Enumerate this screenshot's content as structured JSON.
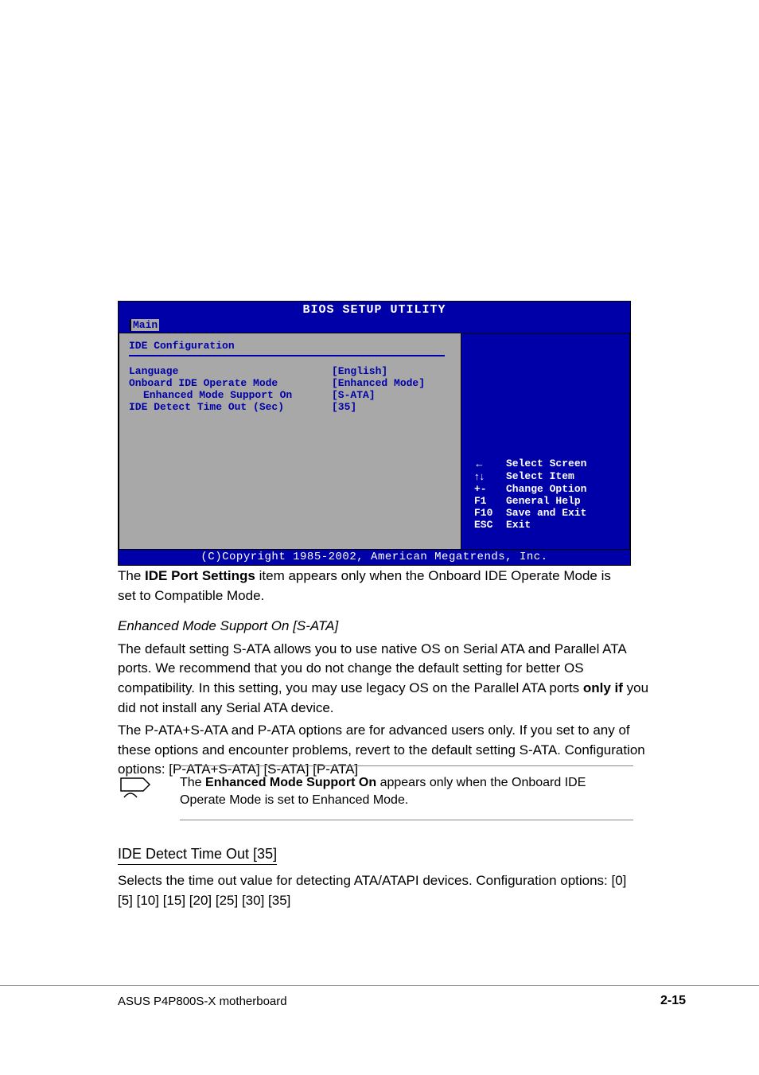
{
  "bios": {
    "title": "BIOS SETUP UTILITY",
    "active_tab": "Main",
    "section_heading": "IDE Configuration",
    "settings": [
      {
        "label": "Language",
        "value": "[English]",
        "indent": false
      },
      {
        "label": "Onboard IDE Operate Mode",
        "value": "[Enhanced Mode]",
        "indent": false
      },
      {
        "label": "Enhanced Mode Support On",
        "value": "[S-ATA]",
        "indent": true
      },
      {
        "label": "IDE Detect Time Out (Sec)",
        "value": "[35]",
        "indent": false
      }
    ],
    "help_keys": [
      {
        "key_glyph": "←",
        "key_text": "",
        "desc": "Select Screen"
      },
      {
        "key_glyph": "↑↓",
        "key_text": "",
        "desc": "Select Item"
      },
      {
        "key_glyph": "",
        "key_text": "+-",
        "desc": "Change Option"
      },
      {
        "key_glyph": "",
        "key_text": "F1",
        "desc": "General Help"
      },
      {
        "key_glyph": "",
        "key_text": "F10",
        "desc": "Save and Exit"
      },
      {
        "key_glyph": "",
        "key_text": "ESC",
        "desc": "Exit"
      }
    ],
    "copyright": "(C)Copyright 1985-2002, American Megatrends, Inc."
  },
  "text": {
    "para1_prefix": "The ",
    "para1_bold": "IDE Port Settings",
    "para1_suffix": " item appears only when the Onboard IDE Operate Mode is set to Compatible Mode.",
    "enhanced_italic": "Enhanced Mode Support On [S-ATA]",
    "enhanced_desc": "The default setting S-ATA allows you to use native OS on Serial ATA and Parallel ATA ports. We recommend that you do not change the default setting for better OS compatibility. In this setting, you may use legacy OS on the Parallel ATA ports ",
    "enhanced_bold_tail": "only if",
    "enhanced_tail2": " you did not install any Serial ATA device.",
    "enhanced_last": "The P-ATA+S-ATA and P-ATA options are for advanced users only. If you set to any of these options and encounter problems, revert to the default setting S-ATA. Configuration options: [P-ATA+S-ATA] [S-ATA] [P-ATA]",
    "note_prefix": "The ",
    "note_bold": "Enhanced Mode Support On",
    "note_suffix": " appears only when the Onboard IDE Operate Mode is set to Enhanced Mode.",
    "subheading": "IDE Detect Time Out [35]",
    "timeout_desc": "Selects the time out value for detecting ATA/ATAPI devices. Configuration options: [0] [5] [10] [15] [20] [25] [30] [35]"
  },
  "footer": {
    "left": "ASUS P4P800S-X motherboard",
    "right": "2-15"
  }
}
